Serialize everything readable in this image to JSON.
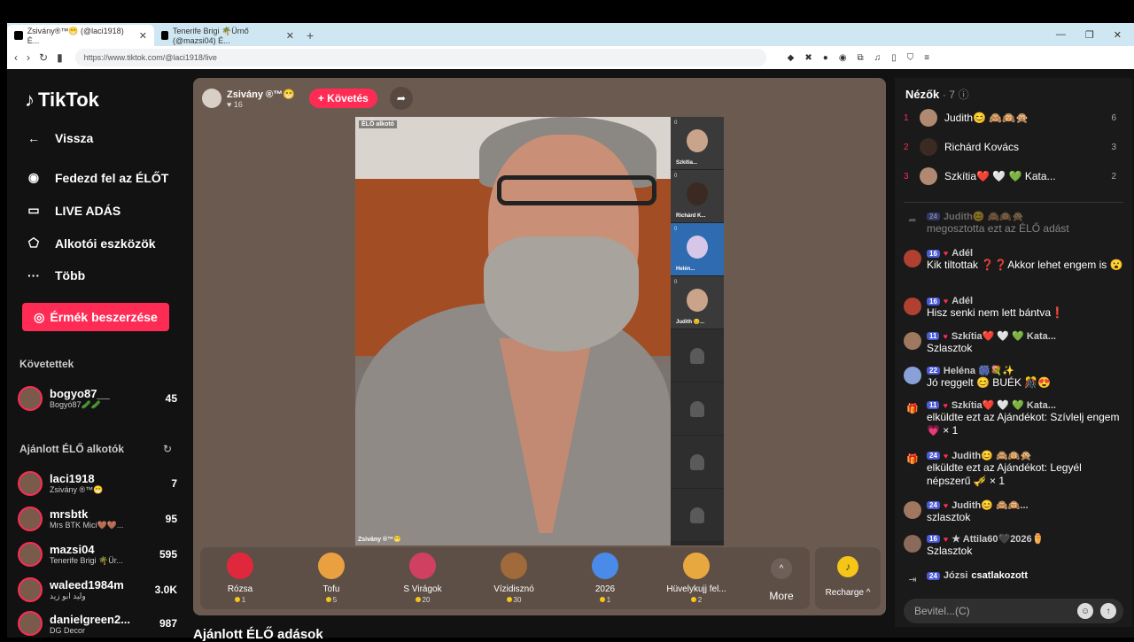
{
  "browser": {
    "tabs": [
      {
        "label": "Zsivány®™😁 (@laci1918) É..."
      },
      {
        "label": "Tenerife Brigi 🌴Ürnő (@mazsi04) É..."
      }
    ],
    "url": "https://www.tiktok.com/@laci1918/live"
  },
  "sidebar": {
    "logo": "TikTok",
    "back": "Vissza",
    "nav": [
      "Fedezd fel az ÉLŐT",
      "LIVE ADÁS",
      "Alkotói eszközök",
      "Több"
    ],
    "coin_button": "Érmék beszerzése",
    "following_title": "Követettek",
    "following": [
      {
        "user": "bogyo87__",
        "name": "Bogyó87🥒🥒",
        "count": "45"
      }
    ],
    "recommended_title": "Ajánlott ÉLŐ alkotók",
    "recommended": [
      {
        "user": "laci1918",
        "name": "Zsivány ®™😁",
        "count": "7"
      },
      {
        "user": "mrsbtk",
        "name": "Mrs BTK Mici🤎🤎...",
        "count": "95"
      },
      {
        "user": "mazsi04",
        "name": "Tenerife Brigi 🌴Ür...",
        "count": "595"
      },
      {
        "user": "waleed1984m",
        "name": "وليد ابو زيد",
        "count": "3.0K"
      },
      {
        "user": "danielgreen2...",
        "name": "DG Decor",
        "count": "987"
      }
    ]
  },
  "stream": {
    "host": "Zsivány ®™😁",
    "likes": "16",
    "follow": "+ Követés",
    "live_label": "ÉLŐ alkotó",
    "host_caption": "Zsivány ®™😁",
    "guests": [
      {
        "name": "Szkítia...",
        "count": "0"
      },
      {
        "name": "Richárd K...",
        "count": "0"
      },
      {
        "name": "Helén...",
        "count": "0"
      },
      {
        "name": "Judith 😊...",
        "count": "0"
      }
    ]
  },
  "gifts": [
    {
      "name": "Rózsa",
      "price": "1",
      "color": "#e0283c"
    },
    {
      "name": "Tofu",
      "price": "5",
      "color": "#e8a040"
    },
    {
      "name": "S Virágok",
      "price": "20",
      "color": "#d04060"
    },
    {
      "name": "Vízidisznó",
      "price": "30",
      "color": "#a06a3a"
    },
    {
      "name": "2026",
      "price": "1",
      "color": "#4a8ae8"
    },
    {
      "name": "Hüvelykujj fel...",
      "price": "2",
      "color": "#e8a840"
    }
  ],
  "more_label": "More",
  "recharge_label": "Recharge ^",
  "recommended_live_title": "Ajánlott ÉLŐ adások",
  "chat": {
    "viewers_title": "Nézők",
    "viewers_count": "· 7",
    "viewers": [
      {
        "rank": "1",
        "name": "Judith😊 🙈🙉🙊",
        "score": "6"
      },
      {
        "rank": "2",
        "name": "Richárd Kovács",
        "score": "3"
      },
      {
        "rank": "3",
        "name": "Szkítia❤️ 🤍 💚 Kata...",
        "score": "2"
      }
    ],
    "messages": [
      {
        "level": "24",
        "user": "Judith😊 🙈🙉🙊",
        "text": "megosztotta ezt az ÉLŐ adást"
      },
      {
        "level": "16",
        "user": "Adél",
        "text": "Kik tiltottak ❓❓Akkor lehet engem is 😮"
      },
      {
        "level": "16",
        "user": "Adél",
        "text": "Hisz senki nem lett bántva❗"
      },
      {
        "level": "11",
        "user": "Szkítia❤️ 🤍 💚 Kata...",
        "text": "Szlasztok"
      },
      {
        "level": "22",
        "user": "Heléna 🎆💐✨",
        "text": "Jó reggelt 😊 BUÉK 🎊😍"
      },
      {
        "level": "11",
        "user": "Szkítia❤️ 🤍 💚 Kata...",
        "text": "elküldte ezt az Ajándékot: Szívlelj engem 💗 × 1"
      },
      {
        "level": "24",
        "user": "Judith😊 🙈🙉🙊",
        "text": "elküldte ezt az Ajándékot: Legyél népszerű 🎺 × 1"
      },
      {
        "level": "24",
        "user": "Judith😊 🙈🙉...",
        "text": "szlasztok"
      },
      {
        "level": "16",
        "user": "★ Attila60🖤2026⚱️",
        "text": "Szlasztok"
      },
      {
        "level": "24",
        "user": "Józsi",
        "text": "csatlakozott"
      }
    ],
    "input_placeholder": "Bevitel...(C)"
  }
}
